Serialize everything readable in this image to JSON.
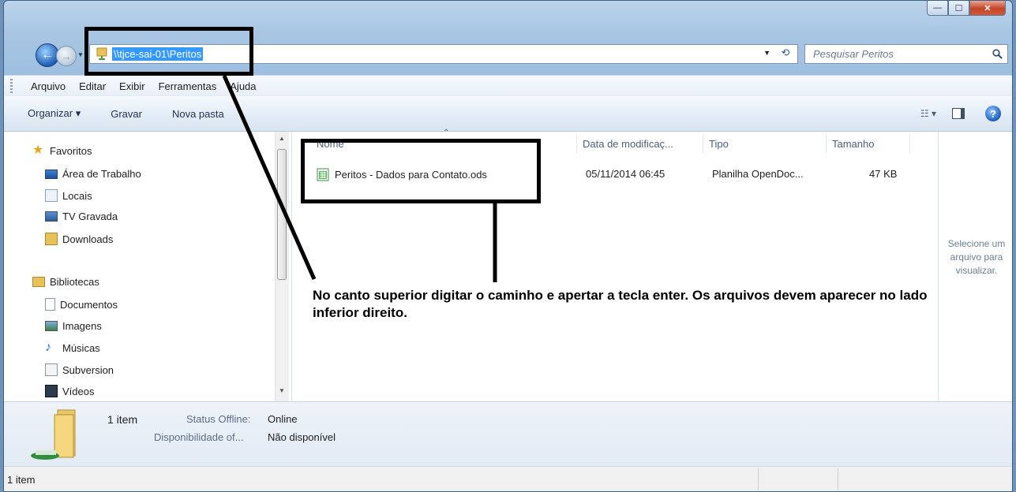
{
  "window": {
    "minimize_glyph": "—",
    "maximize_glyph": "☐",
    "close_glyph": "✕"
  },
  "address": {
    "path": "\\\\tjce-sai-01\\Peritos",
    "search_placeholder": "Pesquisar Peritos"
  },
  "menu": [
    "Arquivo",
    "Editar",
    "Exibir",
    "Ferramentas",
    "Ajuda"
  ],
  "commands": [
    "Organizar ▾",
    "Gravar",
    "Nova pasta"
  ],
  "sidebar": {
    "favorites_label": "Favoritos",
    "favorites": [
      "Área de Trabalho",
      "Locais",
      "TV Gravada",
      "Downloads"
    ],
    "libraries_label": "Bibliotecas",
    "libraries": [
      "Documentos",
      "Imagens",
      "Músicas",
      "Subversion",
      "Vídeos"
    ]
  },
  "columns": [
    "Nome",
    "Data de modificaç...",
    "Tipo",
    "Tamanho"
  ],
  "files": [
    {
      "name": "Peritos - Dados para Contato.ods",
      "modified": "05/11/2014 06:45",
      "type": "Planilha OpenDoc...",
      "size": "47 KB"
    }
  ],
  "preview": "Selecione um arquivo para visualizar.",
  "details": {
    "count": "1 item",
    "status_label": "Status Offline:",
    "status_value": "Online",
    "avail_label": "Disponibilidade of...",
    "avail_value": "Não disponível"
  },
  "statusbar": "1 item",
  "annotation": "No canto superior digitar o caminho e apertar a tecla enter. Os arquivos devem aparecer no lado inferior direito.",
  "colors": {
    "annotation": "#000000",
    "selection": "#3399ff"
  }
}
